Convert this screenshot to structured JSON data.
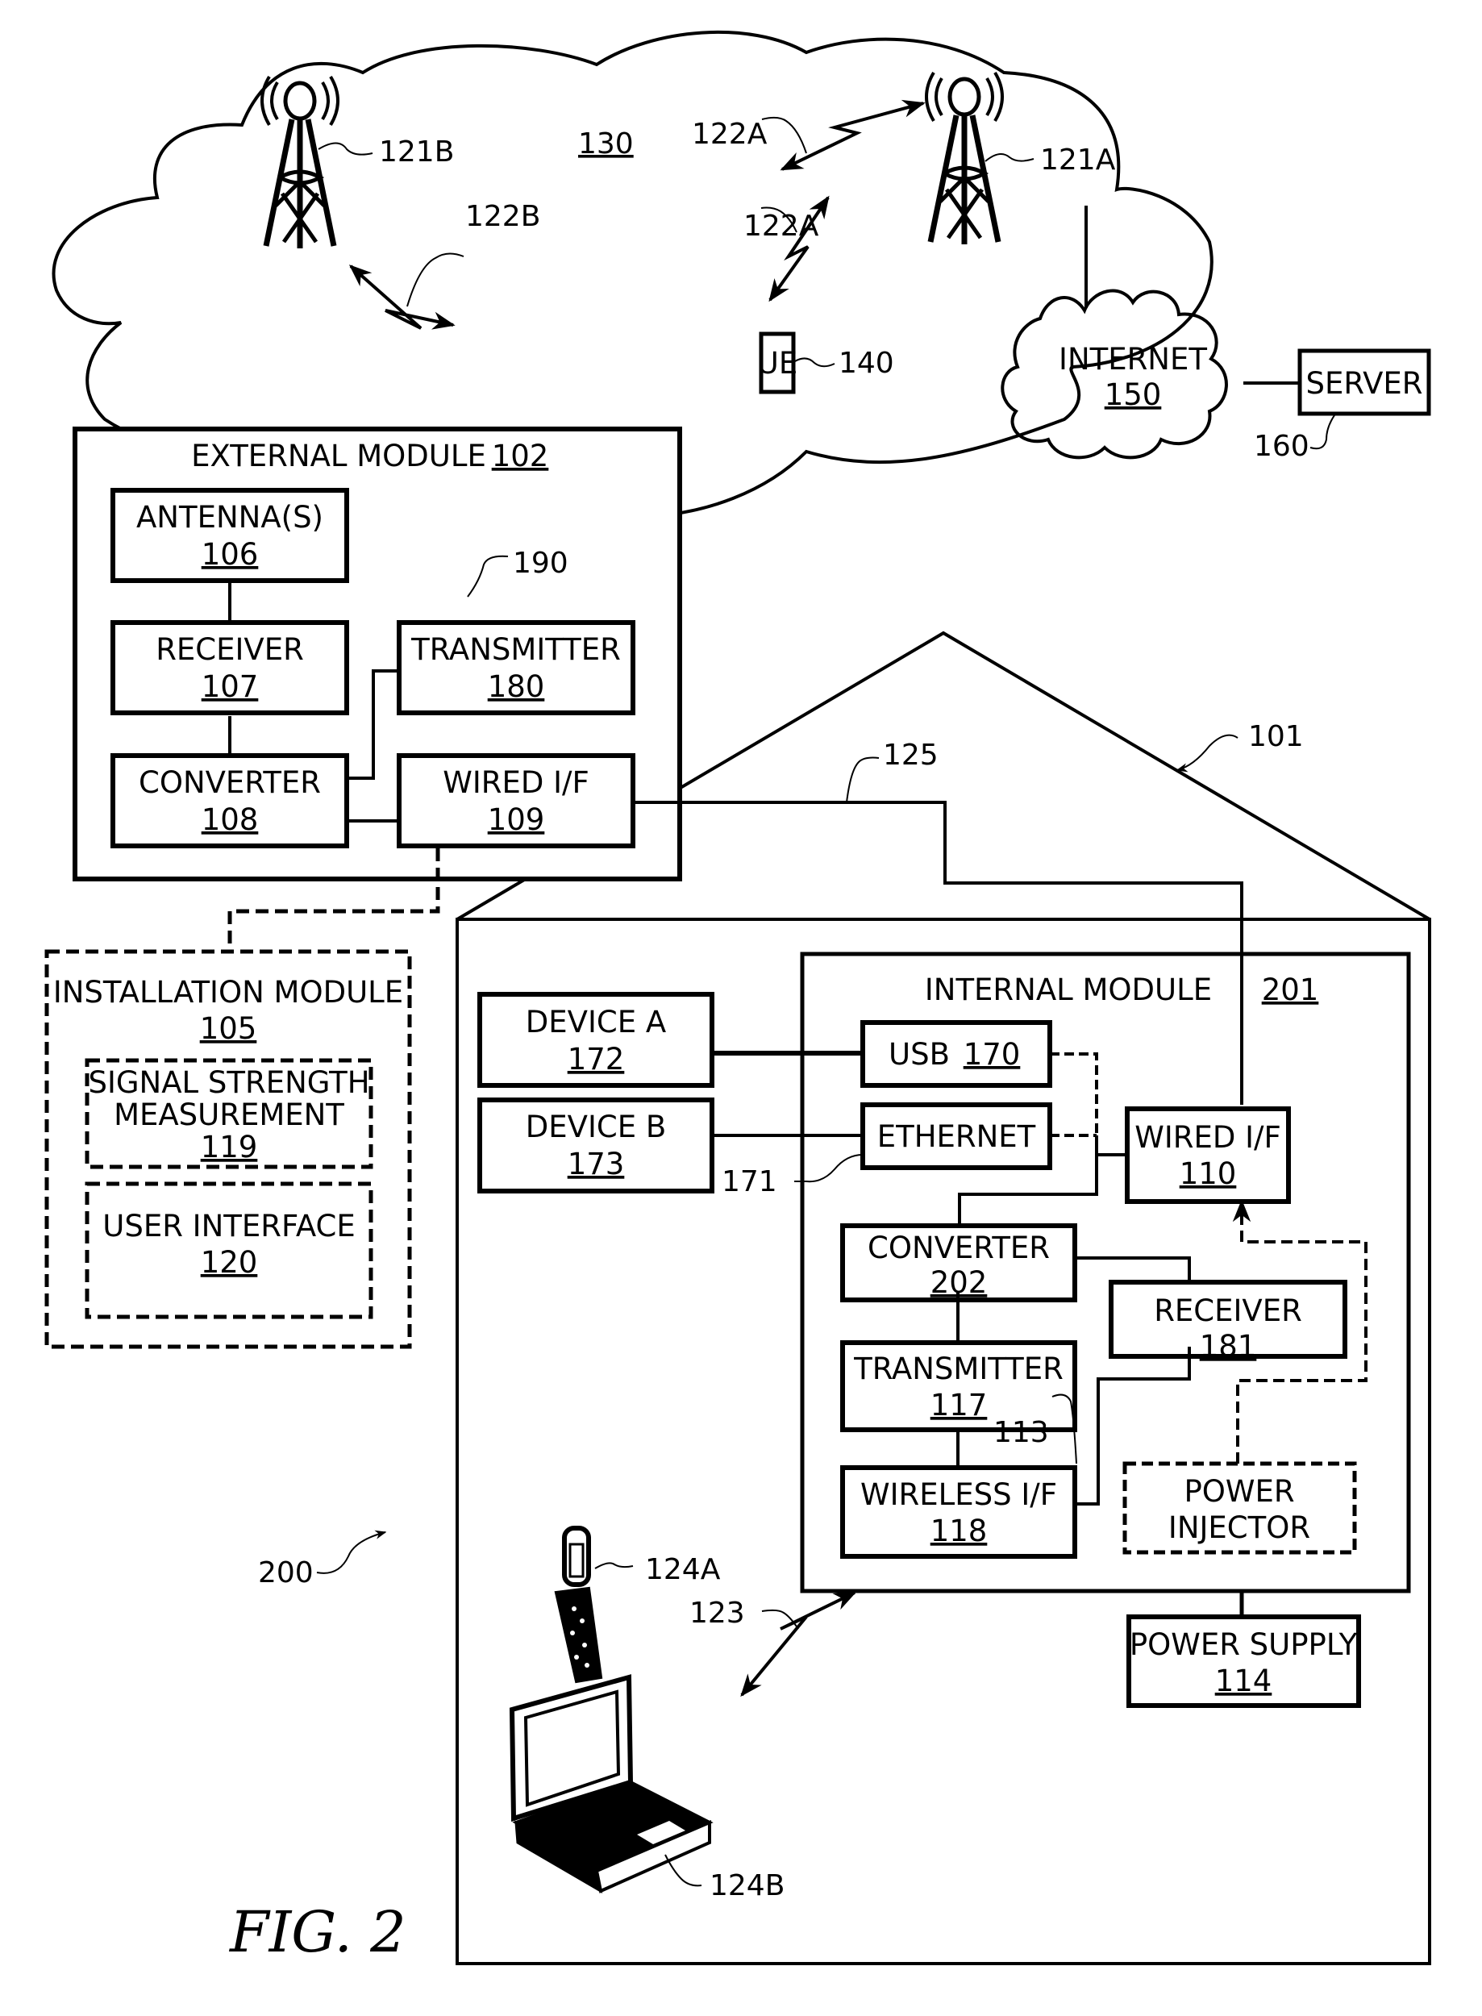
{
  "figure": {
    "caption": "FIG. 2",
    "system_ref": "200",
    "house_ref": "101"
  },
  "network": {
    "cloud_ref": "130",
    "tower_a": {
      "icon": "cell-tower-icon",
      "ref": "121A"
    },
    "tower_b": {
      "icon": "cell-tower-icon",
      "ref": "121B"
    },
    "link_122a_upper": "122A",
    "link_122a_lower": "122A",
    "link_122b": "122B",
    "ue": {
      "label": "UE",
      "ref": "140"
    },
    "internet": {
      "label": "INTERNET",
      "ref": "150"
    },
    "server": {
      "label": "SERVER",
      "ref": "160"
    }
  },
  "external_module": {
    "title": "EXTERNAL MODULE",
    "ref": "102",
    "group_ref": "190",
    "blocks": {
      "antenna": {
        "label": "ANTENNA(S)",
        "ref": "106"
      },
      "receiver": {
        "label": "RECEIVER",
        "ref": "107"
      },
      "converter": {
        "label": "CONVERTER",
        "ref": "108"
      },
      "transmitter": {
        "label": "TRANSMITTER",
        "ref": "180"
      },
      "wired_if": {
        "label": "WIRED I/F",
        "ref": "109"
      }
    }
  },
  "cable_ref": "125",
  "installation_module": {
    "title": "INSTALLATION MODULE",
    "ref": "105",
    "signal_strength": {
      "line1": "SIGNAL STRENGTH",
      "line2": "MEASUREMENT",
      "ref": "119"
    },
    "user_interface": {
      "label": "USER INTERFACE",
      "ref": "120"
    }
  },
  "devices": {
    "device_a": {
      "label": "DEVICE A",
      "ref": "172"
    },
    "device_b": {
      "label": "DEVICE B",
      "ref": "173"
    },
    "ethernet_cable_ref": "171"
  },
  "internal_module": {
    "title": "INTERNAL MODULE",
    "ref": "201",
    "blocks": {
      "usb": {
        "label": "USB",
        "ref": "170"
      },
      "ethernet": {
        "label": "ETHERNET"
      },
      "wired_if": {
        "label": "WIRED I/F",
        "ref": "110"
      },
      "converter": {
        "label": "CONVERTER",
        "ref": "202"
      },
      "receiver": {
        "label": "RECEIVER",
        "ref": "181"
      },
      "transmitter": {
        "label": "TRANSMITTER",
        "ref": "117"
      },
      "wireless_if": {
        "label": "WIRELESS I/F",
        "ref": "118"
      },
      "power_injector": {
        "line1": "POWER",
        "line2": "INJECTOR",
        "ref": "113"
      }
    }
  },
  "power_supply": {
    "label": "POWER SUPPLY",
    "ref": "114"
  },
  "wireless_link_ref": "123",
  "client_devices": {
    "phone": {
      "icon": "flip-phone-icon",
      "ref": "124A"
    },
    "laptop": {
      "icon": "laptop-icon",
      "ref": "124B"
    }
  }
}
